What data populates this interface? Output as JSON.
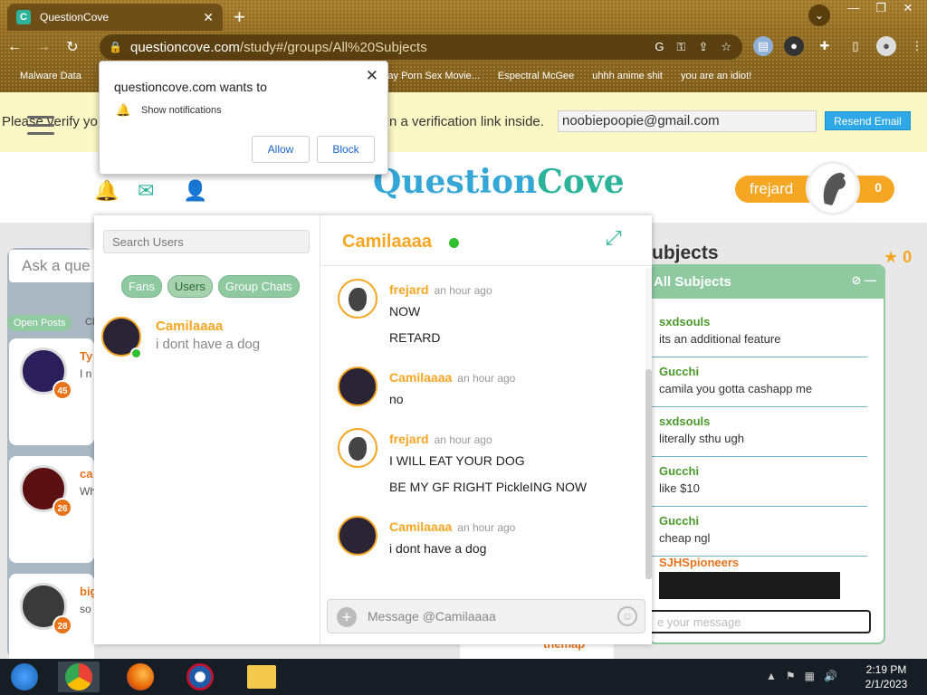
{
  "browser": {
    "tab_title": "QuestionCove",
    "url_host": "questioncove.com",
    "url_path": "/study#/groups/All%20Subjects",
    "bookmarks": [
      "Malware Data",
      "Gay Porn Sex Movie...",
      "Espectral McGee",
      "uhhh anime shit",
      "you are an idiot!"
    ]
  },
  "notification_popup": {
    "title": "questioncove.com wants to",
    "permission": "Show notifications",
    "allow_label": "Allow",
    "block_label": "Block"
  },
  "verify_bar": {
    "text_left": "Please verify yo",
    "text_right": "n a verification link inside.",
    "email": "noobiepoopie@gmail.com",
    "resend_label": "Resend Email"
  },
  "header": {
    "logo_q": "Q",
    "logo_mid": "uestion",
    "logo_c": "C",
    "logo_end": "ove",
    "username": "frejard",
    "count": "0"
  },
  "feed": {
    "ask_placeholder": "Ask a que",
    "open_posts_label": "Open Posts",
    "cl_label": "Cl",
    "posts": [
      {
        "name": "Ty",
        "preview": "I n",
        "badge": "45"
      },
      {
        "name": "ca",
        "preview": "Wh",
        "badge": "26"
      },
      {
        "name": "big",
        "preview": "so",
        "badge": "28"
      }
    ],
    "footer_name": "themap"
  },
  "subjects": {
    "title": "ubjects",
    "star_count": "0",
    "panel_title": "All Subjects",
    "messages": [
      {
        "name": "sxdsouls",
        "text": "its an additional feature"
      },
      {
        "name": "Gucchi",
        "text": "camila you gotta cashapp me"
      },
      {
        "name": "sxdsouls",
        "text": "literally sthu ugh"
      },
      {
        "name": "Gucchi",
        "text": "like $10"
      },
      {
        "name": "Gucchi",
        "text": "cheap ngl"
      }
    ],
    "last_name": "SJHSpioneers",
    "input_placeholder": "e your message"
  },
  "chat": {
    "search_placeholder": "Search Users",
    "tabs": [
      "Fans",
      "Users",
      "Group Chats"
    ],
    "active_tab": "Users",
    "conversation": {
      "name": "Camilaaaa",
      "last": "i dont have a dog"
    },
    "partner_name": "Camilaaaa",
    "messages": [
      {
        "name": "frejard",
        "time": "an hour ago",
        "lines": [
          "NOW",
          "RETARD"
        ]
      },
      {
        "name": "Camilaaaa",
        "time": "an hour ago",
        "lines": [
          "no"
        ]
      },
      {
        "name": "frejard",
        "time": "an hour ago",
        "lines": [
          "I WILL EAT YOUR DOG",
          "BE MY GF RIGHT PickleING NOW"
        ]
      },
      {
        "name": "Camilaaaa",
        "time": "an hour ago",
        "lines": [
          "i dont have a dog"
        ]
      }
    ],
    "input_placeholder": "Message @Camilaaaa"
  },
  "taskbar": {
    "time": "2:19 PM",
    "date": "2/1/2023"
  },
  "colors": {
    "accent_orange": "#f5a623",
    "accent_green": "#8ec9a0",
    "online": "#2ec02e",
    "logo_blue": "#35a7d7"
  }
}
